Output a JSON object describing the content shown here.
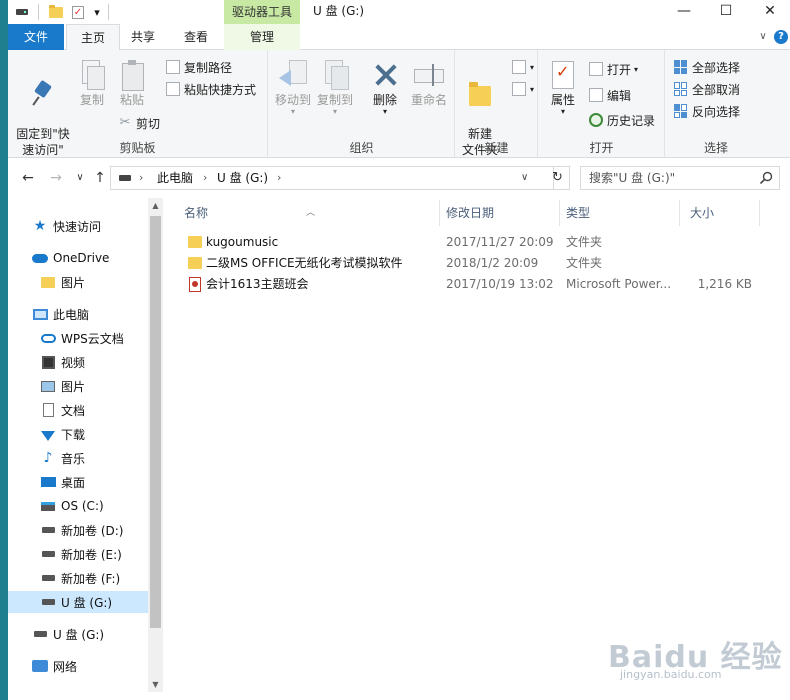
{
  "titlebar": {
    "drive_tools": "驱动器工具",
    "title": "U 盘 (G:)",
    "qa_dropdown": "▾",
    "minimize": "—",
    "maximize": "☐",
    "close": "✕"
  },
  "tabs": {
    "file": "文件",
    "home": "主页",
    "share": "共享",
    "view": "查看",
    "manage": "管理",
    "collapse": "∨",
    "help": "?"
  },
  "ribbon": {
    "clipboard": {
      "pin": "固定到\"快\n速访问\"",
      "copy": "复制",
      "paste": "粘贴",
      "copy_path": "复制路径",
      "paste_shortcut": "粘贴快捷方式",
      "cut": "剪切",
      "label": "剪贴板"
    },
    "organize": {
      "move_to": "移动到",
      "copy_to": "复制到",
      "delete": "删除",
      "rename": "重命名",
      "label": "组织"
    },
    "new": {
      "new_folder": "新建\n文件夹",
      "label": "新建"
    },
    "open": {
      "properties": "属性",
      "open": "打开",
      "edit": "编辑",
      "history": "历史记录",
      "label": "打开"
    },
    "select": {
      "select_all": "全部选择",
      "select_none": "全部取消",
      "invert": "反向选择",
      "label": "选择"
    }
  },
  "address": {
    "back": "←",
    "forward": "→",
    "recent": "∨",
    "up": "↑",
    "crumb_pc": "此电脑",
    "crumb_drive": "U 盘 (G:)",
    "sep": "›",
    "dropdown": "∨",
    "refresh": "↻",
    "search_placeholder": "搜索\"U 盘 (G:)\""
  },
  "nav": {
    "items": [
      {
        "label": "快速访问"
      },
      {
        "label": "OneDrive"
      },
      {
        "label": "图片"
      },
      {
        "label": "此电脑"
      },
      {
        "label": "WPS云文档"
      },
      {
        "label": "视频"
      },
      {
        "label": "图片"
      },
      {
        "label": "文档"
      },
      {
        "label": "下载"
      },
      {
        "label": "音乐"
      },
      {
        "label": "桌面"
      },
      {
        "label": "OS (C:)"
      },
      {
        "label": "新加卷 (D:)"
      },
      {
        "label": "新加卷 (E:)"
      },
      {
        "label": "新加卷 (F:)"
      },
      {
        "label": "U 盘 (G:)"
      },
      {
        "label": "U 盘 (G:)"
      },
      {
        "label": "网络"
      }
    ]
  },
  "columns": {
    "name": "名称",
    "date": "修改日期",
    "type": "类型",
    "size": "大小"
  },
  "files": [
    {
      "name": "kugoumusic",
      "date": "2017/11/27 20:09",
      "type": "文件夹",
      "size": ""
    },
    {
      "name": "二级MS OFFICE无纸化考试模拟软件",
      "date": "2018/1/2 20:09",
      "type": "文件夹",
      "size": ""
    },
    {
      "name": "会计1613主题班会",
      "date": "2017/10/19 13:02",
      "type": "Microsoft Power...",
      "size": "1,216 KB"
    }
  ],
  "watermark": {
    "main": "Baidu 经验",
    "sub": "jingyan.baidu.com"
  },
  "colors": {
    "accent": "#1979ca",
    "drive_tools_bg": "#c7e9a4",
    "selection": "#cce8ff"
  }
}
